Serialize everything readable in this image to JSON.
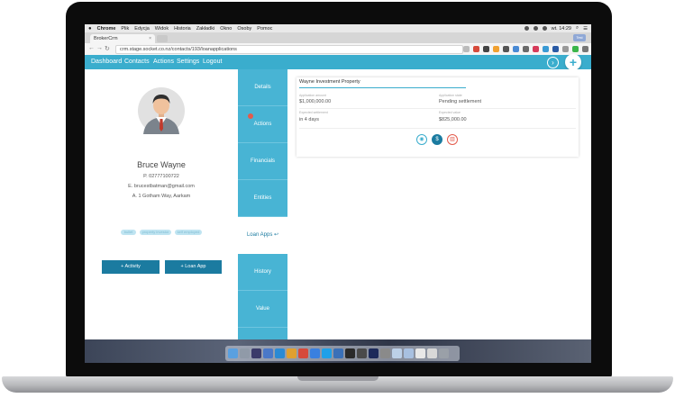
{
  "mac_menubar": {
    "items": [
      "Chrome",
      "Plik",
      "Edycja",
      "Widok",
      "Historia",
      "Zakładki",
      "Okno",
      "Osoby",
      "Pomoc"
    ],
    "clock": "wt. 14:29"
  },
  "browser": {
    "tab_title": "BrokerCrm",
    "tab_close": "×",
    "url": "crm.stage.socket.co.nz/contacts/193/loanapplications",
    "profile": "Test"
  },
  "app_nav": {
    "links": [
      "Dashboard",
      "Contacts",
      "Actions",
      "Settings",
      "Logout"
    ],
    "circle_button": "›",
    "add_button": "+"
  },
  "contact": {
    "name": "Bruce Wayne",
    "phone": "P. 02777100722",
    "email": "E. brucestbatman@gmail.com",
    "address": "A. 1 Gotham Way, Aarkam",
    "tags": [
      "bullet",
      "property investor",
      "self employed"
    ],
    "buttons": {
      "add_activity": "+ Activity",
      "add_loan_app": "+ Loan App"
    }
  },
  "side_menu": {
    "items": [
      "Details",
      "Actions",
      "Financials",
      "Entities",
      "Loan Apps",
      "History",
      "Value"
    ],
    "active": "Loan Apps",
    "active_icon": "↩"
  },
  "loan_card": {
    "title": "Wayne Investment Property",
    "application_amount_label": "Application amount",
    "application_amount": "$1,000,000.00",
    "application_state_label": "Application state",
    "application_state": "Pending settlement",
    "expected_settlement_label": "Expected settlement",
    "expected_settlement": "in 4 days",
    "expected_value_label": "Expected value",
    "expected_value": "$825,000.00"
  },
  "colors": {
    "accent": "#3aadcd",
    "side_menu": "#48b4d4",
    "button": "#1b7ba0",
    "delete": "#e45b4c"
  }
}
